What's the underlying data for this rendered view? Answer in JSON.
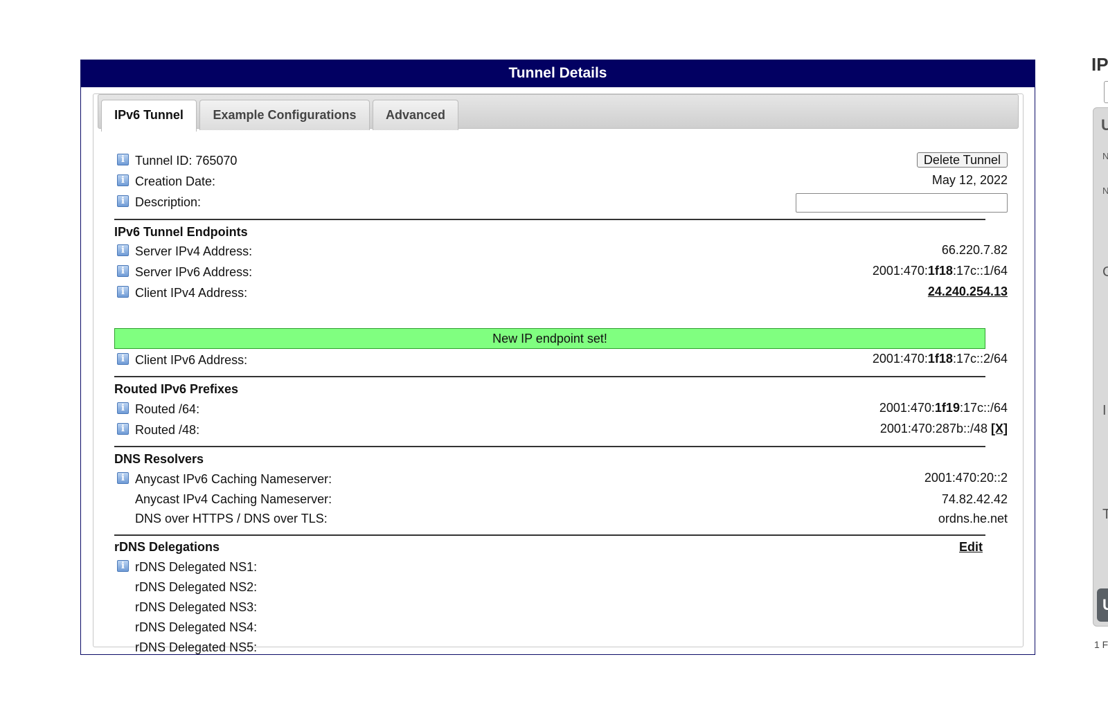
{
  "panel": {
    "title": "Tunnel Details"
  },
  "tabs": [
    {
      "label": "IPv6 Tunnel",
      "active": true
    },
    {
      "label": "Example Configurations",
      "active": false
    },
    {
      "label": "Advanced",
      "active": false
    }
  ],
  "details": {
    "tunnel_id_label": "Tunnel ID: 765070",
    "delete_button": "Delete Tunnel",
    "creation_date_label": "Creation Date:",
    "creation_date_value": "May 12, 2022",
    "description_label": "Description:",
    "description_value": ""
  },
  "endpoints": {
    "heading": "IPv6 Tunnel Endpoints",
    "server_ipv4_label": "Server IPv4 Address:",
    "server_ipv4_value": "66.220.7.82",
    "server_ipv6_label": "Server IPv6 Address:",
    "server_ipv6_prefix": "2001:470:",
    "server_ipv6_bold": "1f18",
    "server_ipv6_suffix": ":17c::1/64",
    "client_ipv4_label": "Client IPv4 Address:",
    "client_ipv4_value": "24.240.254.13",
    "notice": "New IP endpoint set!",
    "client_ipv6_label": "Client IPv6 Address:",
    "client_ipv6_prefix": "2001:470:",
    "client_ipv6_bold": "1f18",
    "client_ipv6_suffix": ":17c::2/64"
  },
  "routed": {
    "heading": "Routed IPv6 Prefixes",
    "r64_label": "Routed /64:",
    "r64_prefix": "2001:470:",
    "r64_bold": "1f19",
    "r64_suffix": ":17c::/64",
    "r48_label": "Routed /48:",
    "r48_value": "2001:470:287b::/48 ",
    "r48_remove": "[X]"
  },
  "dns": {
    "heading": "DNS Resolvers",
    "ipv6_label": "Anycast IPv6 Caching Nameserver:",
    "ipv6_value": "2001:470:20::2",
    "ipv4_label": "Anycast IPv4 Caching Nameserver:",
    "ipv4_value": "74.82.42.42",
    "doh_label": "DNS over HTTPS / DNS over TLS:",
    "doh_value": "ordns.he.net"
  },
  "rdns": {
    "heading": "rDNS Delegations",
    "edit": "Edit",
    "ns": [
      "rDNS Delegated NS1:",
      "rDNS Delegated NS2:",
      "rDNS Delegated NS3:",
      "rDNS Delegated NS4:",
      "rDNS Delegated NS5:"
    ]
  },
  "side": {
    "title": "IP",
    "letters": [
      "U",
      "N",
      "N",
      "C",
      "I",
      "T"
    ],
    "button": "U",
    "footer": "1 F"
  },
  "icons": {
    "info": "info-icon"
  },
  "colors": {
    "header_bg": "#020062",
    "notice_bg": "#80ff80"
  }
}
